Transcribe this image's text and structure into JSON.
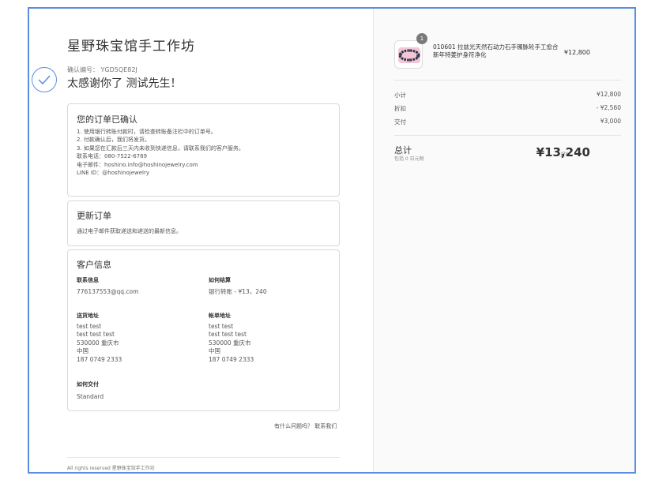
{
  "shop": {
    "title": "星野珠宝馆手工作坊"
  },
  "confirmation": {
    "number_text": "确认编号： YGD5QE82J",
    "thanks_text": "太感谢你了 测试先生！"
  },
  "order_confirmed": {
    "title": "您的订单已确认",
    "lines": [
      "1. 使用银行转账付款时，请检查转账备注栏中的订单号。",
      "2. 付款确认后，我们将发货。",
      "3. 如果您在汇款后三天内未收到快递信息，请联系我们的客户服务。",
      "联系电话：080-7522-6789",
      "电子邮件：hoshino.info@hoshinojewelry.com",
      "LINE ID：@hoshinojewelry"
    ]
  },
  "update_order": {
    "title": "更新订单",
    "text": "通过电子邮件获取递送和递送的最新信息。"
  },
  "customer_info": {
    "title": "客户信息",
    "contact": {
      "label": "联系信息",
      "value": "776137553@qq.com"
    },
    "payment": {
      "label": "如何结算",
      "value": "银行转账 - ¥13，240"
    },
    "shipping": {
      "label": "送货地址",
      "lines": [
        "test test",
        "test test test",
        "530000 重庆市",
        "中国",
        "187 0749 2333"
      ]
    },
    "billing": {
      "label": "帐单地址",
      "lines": [
        "test test",
        "test test test",
        "530000 重庆市",
        "中国",
        "187 0749 2333"
      ]
    },
    "delivery": {
      "label": "如何交付",
      "value": "Standard"
    }
  },
  "help": {
    "question": "有什么问题吗？",
    "link": "联系我们"
  },
  "footer": {
    "text": "All rights reserved 星野珠宝馆手工作坊"
  },
  "summary": {
    "product": {
      "qty_badge": "1",
      "name": "010601 拉兹光天然石动力石手镯脉轮手工愈合新年特姜护身符净化",
      "price": "¥12,800",
      "icon": "bracelet-image"
    },
    "rows": [
      {
        "label": "小计",
        "amount": "¥12,800"
      },
      {
        "label": "折扣",
        "amount": "- ¥2,560"
      },
      {
        "label": "交付",
        "amount": "¥3,000"
      }
    ],
    "total": {
      "label": "总计",
      "tax_note": "包括 0 日元税",
      "currency": "JPY",
      "amount": "¥13,240"
    }
  },
  "colors": {
    "accent": "#5b8ee0",
    "border": "#d9d9d9",
    "panel": "#fafafa"
  }
}
